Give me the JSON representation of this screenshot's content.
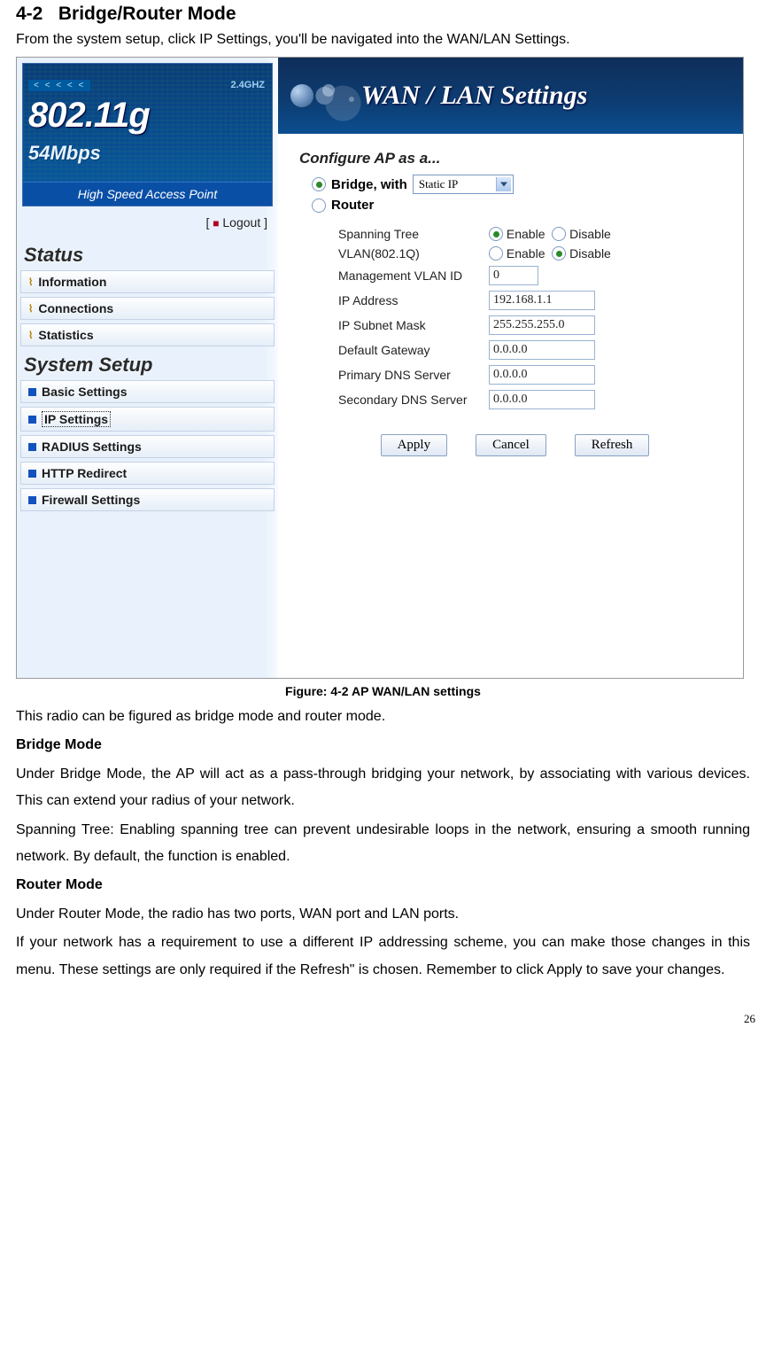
{
  "doc": {
    "section_number": "4-2",
    "section_title": "Bridge/Router Mode",
    "intro": "From the system setup, click IP Settings, you'll be navigated into the WAN/LAN Settings.",
    "caption": "Figure: 4-2 AP WAN/LAN settings",
    "p1": "This radio can be figured as bridge mode and router mode.",
    "h_bridge": "Bridge Mode",
    "p2": "Under Bridge Mode, the AP will act as a pass-through bridging your network, by associating with various devices. This can extend your radius of your network.",
    "p3": "Spanning Tree: Enabling spanning tree can prevent undesirable loops in the network, ensuring a smooth running network. By default, the function is enabled.",
    "h_router": "Router Mode",
    "p4": "Under Router Mode, the radio has two ports, WAN port and LAN ports.",
    "p5": "If your network has a requirement to use a different IP addressing scheme, you can make those changes in this menu. These settings are only required if the Refresh\" is chosen. Remember to click Apply to save your changes.",
    "page_number": "26"
  },
  "ui": {
    "logo": {
      "chevrons": "< < < < <",
      "ghz": "2.4GHZ",
      "main": "802.11g",
      "sub": "54Mbps",
      "tagline": "High Speed Access Point"
    },
    "logout_left": "[",
    "logout_text": "Logout ]",
    "sidebar": {
      "status_header": "Status",
      "status_items": [
        "Information",
        "Connections",
        "Statistics"
      ],
      "setup_header": "System Setup",
      "setup_items": [
        "Basic Settings",
        "IP Settings",
        "RADIUS Settings",
        "HTTP Redirect",
        "Firewall Settings"
      ]
    },
    "banner_title": "WAN / LAN Settings",
    "panel": {
      "configure_head": "Configure AP as a...",
      "bridge_label": "Bridge, with",
      "bridge_select": "Static IP",
      "router_label": "Router",
      "rows": {
        "spanning_tree": "Spanning Tree",
        "vlan": "VLAN(802.1Q)",
        "mgmt_vlan": "Management VLAN ID",
        "ip_addr": "IP Address",
        "subnet": "IP Subnet Mask",
        "gateway": "Default Gateway",
        "pdns": "Primary DNS Server",
        "sdns": "Secondary DNS Server"
      },
      "enable": "Enable",
      "disable": "Disable",
      "values": {
        "mgmt_vlan": "0",
        "ip_addr": "192.168.1.1",
        "subnet": "255.255.255.0",
        "gateway": "0.0.0.0",
        "pdns": "0.0.0.0",
        "sdns": "0.0.0.0"
      },
      "buttons": {
        "apply": "Apply",
        "cancel": "Cancel",
        "refresh": "Refresh"
      }
    }
  }
}
